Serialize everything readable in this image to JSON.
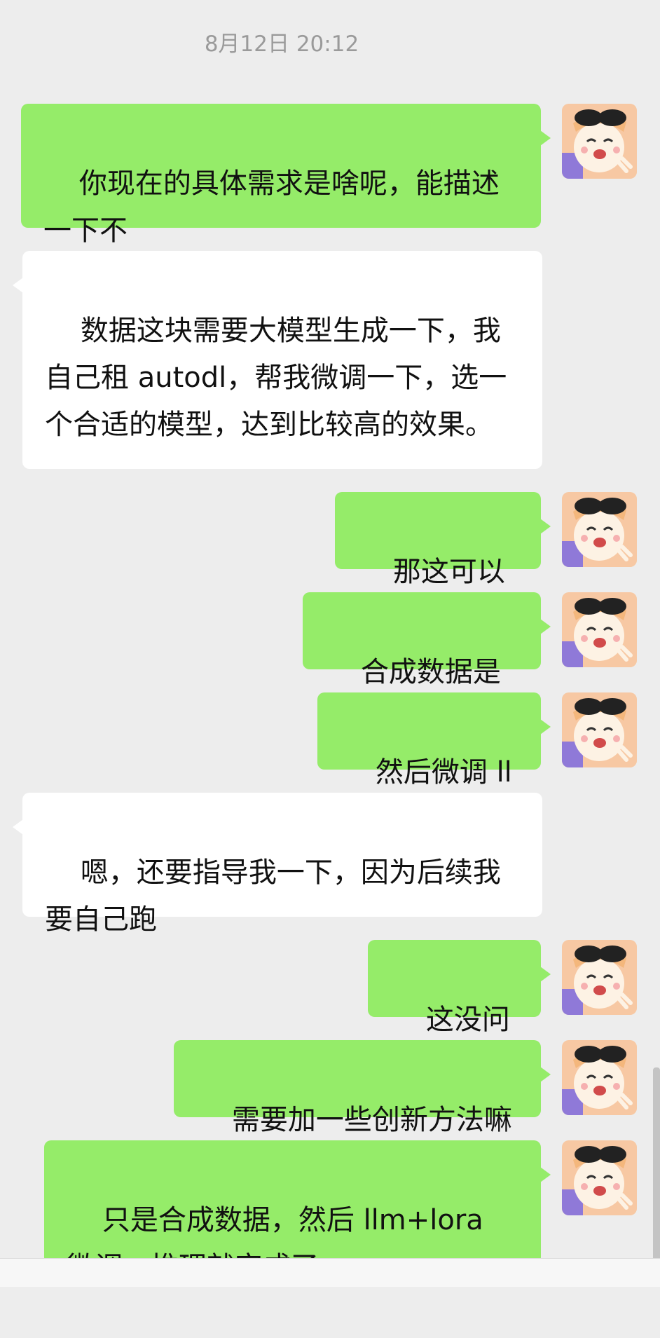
{
  "chat": {
    "timestamp": "8月12日 20:12",
    "messages": [
      {
        "side": "out",
        "text": "你现在的具体需求是啥呢，能描述一下不"
      },
      {
        "side": "in",
        "text": "数据这块需要大模型生成一下，我自己租 autodl，帮我微调一下，选一个合适的模型，达到比较高的效果。"
      },
      {
        "side": "out",
        "text": "那这可以的"
      },
      {
        "side": "out",
        "text": "合成数据是吧"
      },
      {
        "side": "out",
        "text": "然后微调 llm"
      },
      {
        "side": "in",
        "text": "嗯，还要指导我一下，因为后续我要自己跑"
      },
      {
        "side": "out",
        "text": "这没问题"
      },
      {
        "side": "out",
        "text": "需要加一些创新方法嘛"
      },
      {
        "side": "out",
        "text": "只是合成数据，然后 llm+lora 微调，推理就完成了"
      }
    ]
  },
  "colors": {
    "outgoing_bubble": "#95ec69",
    "incoming_bubble": "#ffffff",
    "background": "#ededed"
  },
  "icons": {
    "avatar": "anime-avatar-with-sunglasses-icon"
  }
}
